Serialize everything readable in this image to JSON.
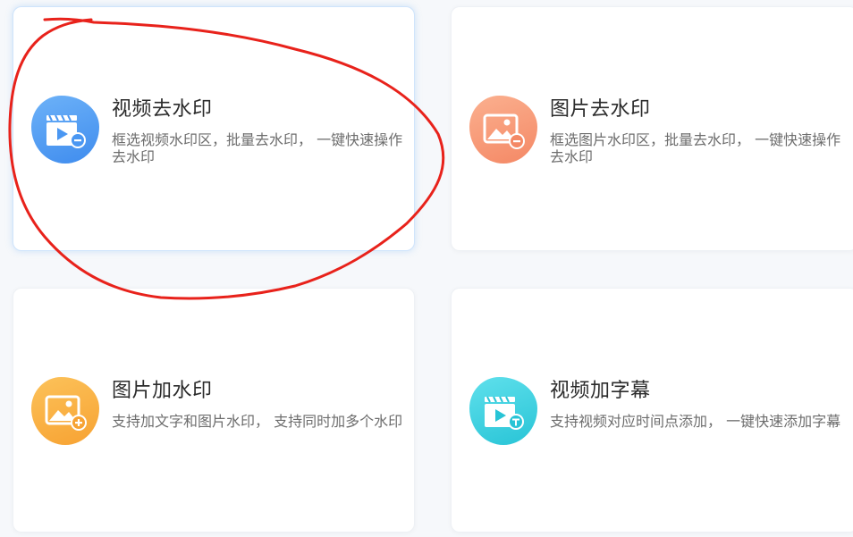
{
  "colors": {
    "video_remove_accent": "#4a97f2",
    "image_remove_accent": "#f7956f",
    "image_add_accent": "#f9ad3c",
    "video_subtitle_accent": "#3dd3e2",
    "annotation_red": "#e8221b"
  },
  "cards": [
    {
      "title": "视频去水印",
      "description": "框选视频水印区，批量去水印， 一键快速操作去水印",
      "icon": "video-remove-watermark-icon",
      "selected": true
    },
    {
      "title": "图片去水印",
      "description": "框选图片水印区，批量去水印， 一键快速操作去水印",
      "icon": "image-remove-watermark-icon",
      "selected": false
    },
    {
      "title": "图片加水印",
      "description": "支持加文字和图片水印， 支持同时加多个水印",
      "icon": "image-add-watermark-icon",
      "selected": false
    },
    {
      "title": "视频加字幕",
      "description": "支持视频对应时间点添加， 一键快速添加字幕",
      "icon": "video-add-subtitle-icon",
      "selected": false
    }
  ]
}
